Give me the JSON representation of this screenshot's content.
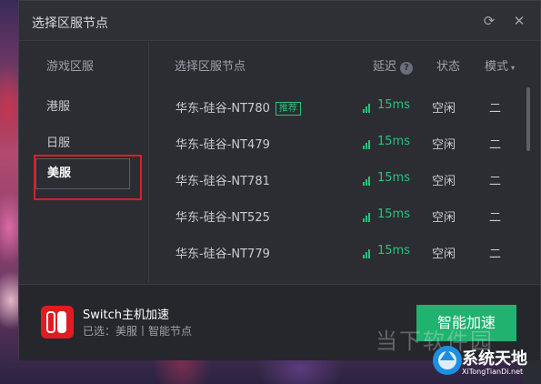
{
  "window": {
    "title": "选择区服节点"
  },
  "icons": {
    "refresh": "refresh-icon",
    "close": "close-icon"
  },
  "left": {
    "heading": "游戏区服",
    "regions": [
      "港服",
      "日服",
      "美服"
    ],
    "selected": "美服"
  },
  "table": {
    "headers": {
      "node": "选择区服节点",
      "latency": "延迟",
      "status": "状态",
      "mode": "模式"
    },
    "rows": [
      {
        "node": "华东-硅谷-NT780",
        "tag": "推荐",
        "latency": "15ms",
        "status": "空闲",
        "mode": "二"
      },
      {
        "node": "华东-硅谷-NT479",
        "latency": "15ms",
        "status": "空闲",
        "mode": "二"
      },
      {
        "node": "华东-硅谷-NT781",
        "latency": "15ms",
        "status": "空闲",
        "mode": "二"
      },
      {
        "node": "华东-硅谷-NT525",
        "latency": "15ms",
        "status": "空闲",
        "mode": "二"
      },
      {
        "node": "华东-硅谷-NT779",
        "latency": "15ms",
        "status": "空闲",
        "mode": "二"
      }
    ]
  },
  "footer": {
    "title": "Switch主机加速",
    "subtitle": "已选：美服丨智能节点",
    "button": "智能加速"
  },
  "watermark": {
    "text": "当下软件园",
    "brand": "系统天地",
    "url": "XiTongTianDi.net"
  },
  "colors": {
    "accent": "#20b26e",
    "highlight": "#e21b23",
    "bg": "#2b2d33"
  }
}
